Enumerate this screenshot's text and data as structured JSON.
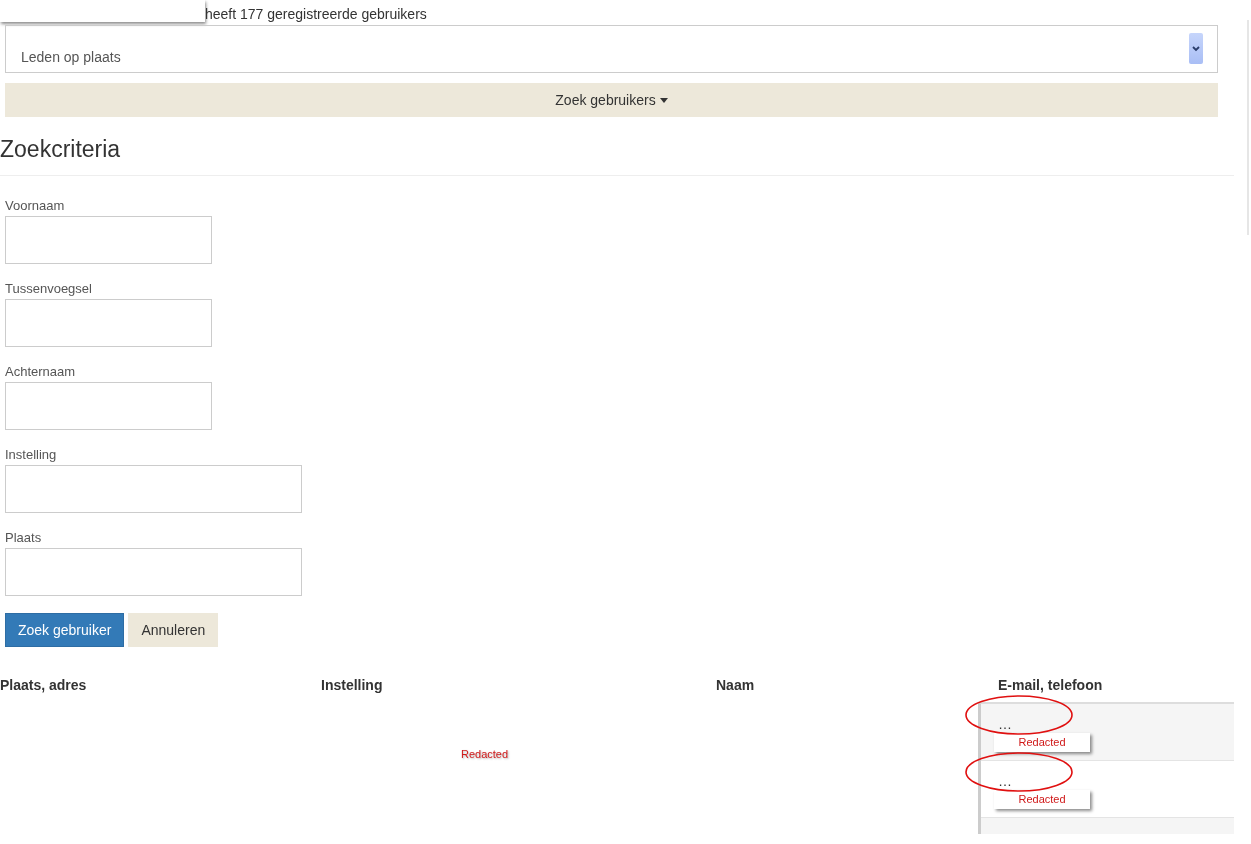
{
  "header": {
    "user_count_text": "heeft 177 geregistreerde gebruikers"
  },
  "view_select": {
    "value": "Leden op plaats"
  },
  "search_toggle": {
    "label": "Zoek gebruikers",
    "expanded": true
  },
  "criteria": {
    "title": "Zoekcriteria",
    "fields": [
      {
        "label": "Voornaam",
        "wide": false
      },
      {
        "label": "Tussenvoegsel",
        "wide": false
      },
      {
        "label": "Achternaam",
        "wide": false
      },
      {
        "label": "Instelling",
        "wide": true
      },
      {
        "label": "Plaats",
        "wide": true
      }
    ]
  },
  "buttons": [
    {
      "label": "Zoek gebruiker",
      "kind": "primary"
    },
    {
      "label": "Annuleren",
      "kind": "secondary"
    }
  ],
  "table": {
    "columns": [
      "Plaats, adres",
      "Instelling",
      "Naam",
      "E-mail, telefoon"
    ],
    "redaction_label": "Redacted",
    "rows": [
      {
        "contact": "…",
        "redaction_label": "Redacted"
      },
      {
        "contact": "…",
        "redaction_label": "Redacted"
      }
    ]
  }
}
